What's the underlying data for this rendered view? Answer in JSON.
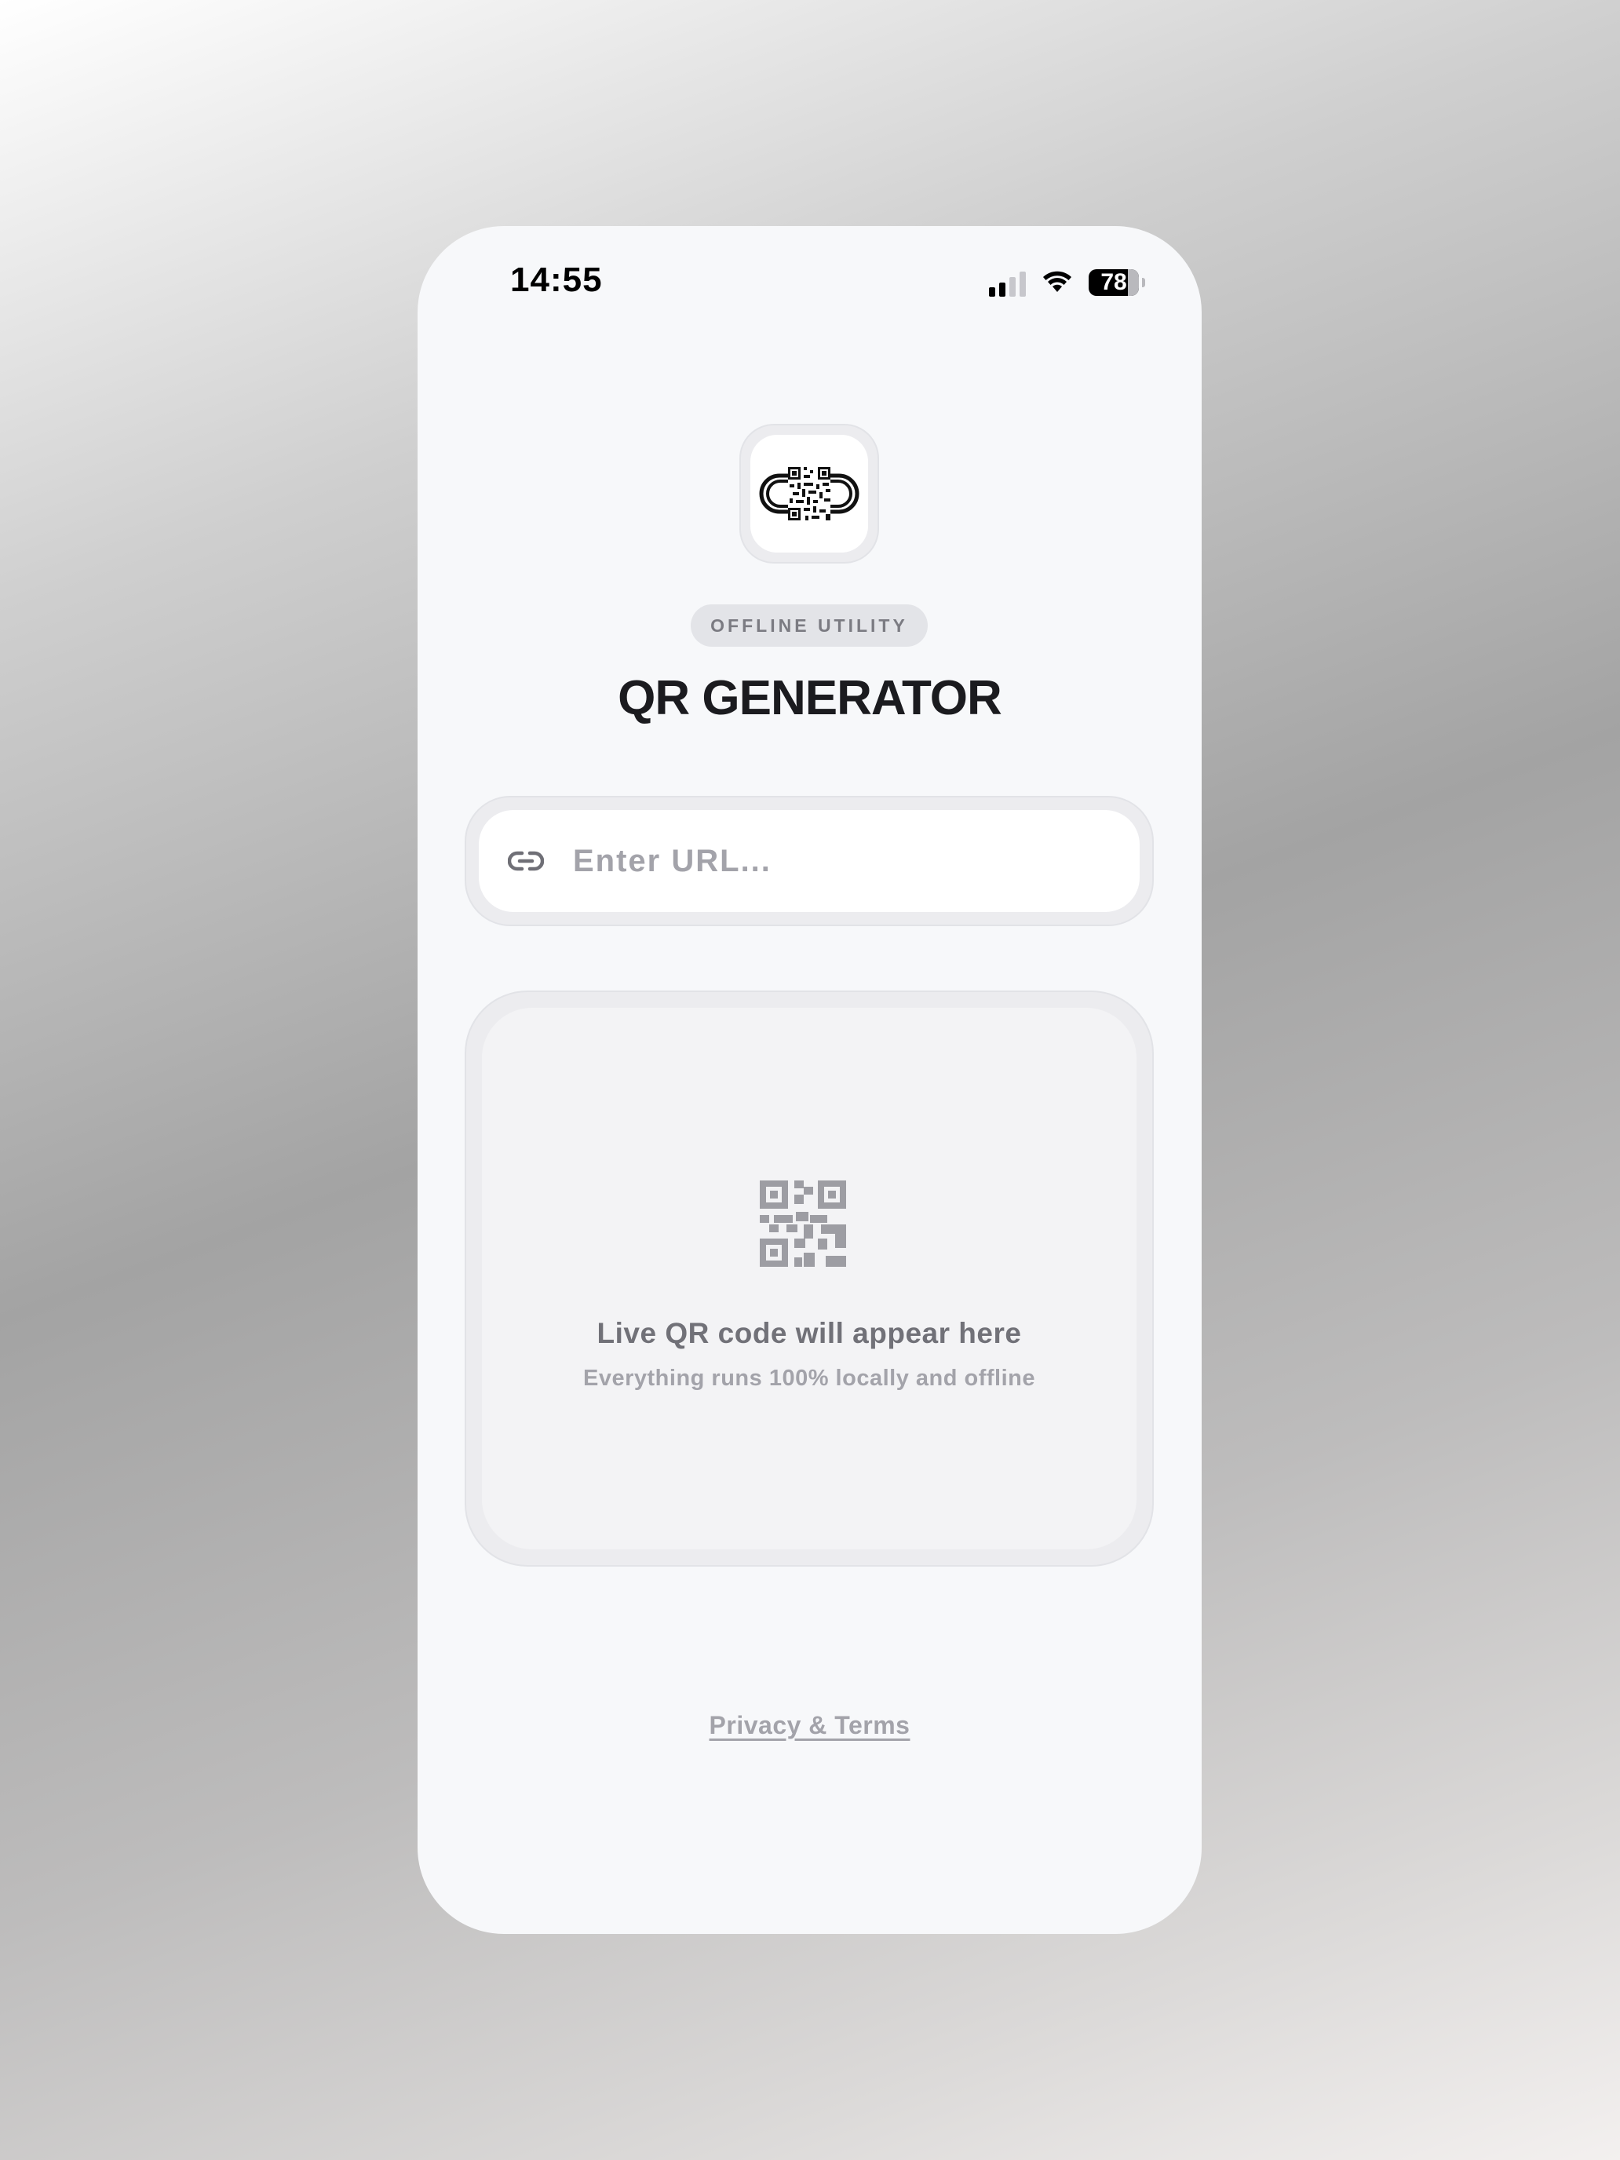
{
  "status_bar": {
    "time": "14:55",
    "battery": "78",
    "icons": [
      "cellular-signal-icon",
      "wifi-icon",
      "battery-icon"
    ]
  },
  "app_icon": "qr-link-logo-icon",
  "header": {
    "badge": "OFFLINE UTILITY",
    "title": "QR GENERATOR"
  },
  "url_input": {
    "icon": "link-icon",
    "placeholder": "Enter URL...",
    "value": ""
  },
  "preview": {
    "icon": "qr-code-icon",
    "title": "Live QR code will appear here",
    "subtitle": "Everything runs 100% locally and offline"
  },
  "footer": {
    "link": "Privacy & Terms"
  },
  "colors": {
    "title": "#1b1b1f",
    "muted": "#a3a3aa",
    "badge_bg": "#e3e4e8",
    "surface": "#f7f8fa"
  }
}
